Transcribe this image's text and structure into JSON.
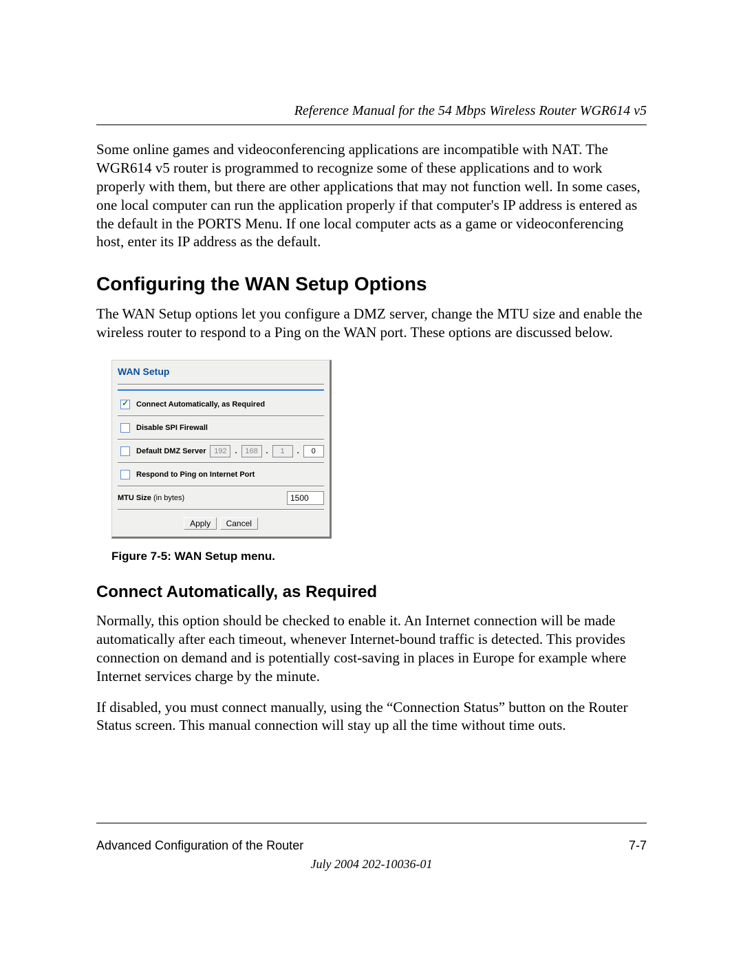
{
  "header": {
    "running_head": "Reference Manual for the 54 Mbps Wireless Router WGR614 v5"
  },
  "intro_paragraph": "Some online games and videoconferencing applications are incompatible with NAT. The WGR614 v5 router is programmed to recognize some of these applications and to work properly with them, but there are other applications that may not function well. In some cases, one local computer can run the application properly if that computer's IP address is entered as the default in the PORTS Menu. If one local computer acts as a game or videoconferencing host, enter its IP address as the default.",
  "section": {
    "title": "Configuring the WAN Setup Options",
    "body": "The WAN Setup options let you configure a DMZ server, change the MTU size and enable the wireless router to respond to a Ping on the WAN port. These options are discussed below."
  },
  "caption": "Figure 7-5:  WAN Setup menu.",
  "wan_panel": {
    "title": "WAN Setup",
    "rows": {
      "connect_auto": {
        "label": "Connect Automatically, as Required",
        "checked": true
      },
      "disable_spi": {
        "label": "Disable SPI Firewall",
        "checked": false
      },
      "dmz": {
        "label": "Default DMZ Server",
        "checked": false,
        "ip": [
          "192",
          "168",
          "1",
          "0"
        ]
      },
      "respond_ping": {
        "label": "Respond to Ping on Internet Port",
        "checked": false
      },
      "mtu": {
        "label": "MTU Size",
        "paren": "(in bytes)",
        "value": "1500"
      }
    },
    "buttons": {
      "apply": "Apply",
      "cancel": "Cancel"
    }
  },
  "subsection": {
    "title": "Connect Automatically, as Required",
    "p1": "Normally, this option should be checked to enable it. An Internet connection will be made automatically after each timeout, whenever Internet-bound traffic is detected. This provides connection on demand and is potentially cost-saving in places in Europe for example where Internet services charge by the minute.",
    "p2": "If disabled, you must connect manually, using the “Connection Status” button on the Router Status screen. This manual connection will stay up all the time without time outs."
  },
  "footer": {
    "left": "Advanced Configuration of the Router",
    "right": "7-7",
    "date": "July 2004 202-10036-01"
  }
}
